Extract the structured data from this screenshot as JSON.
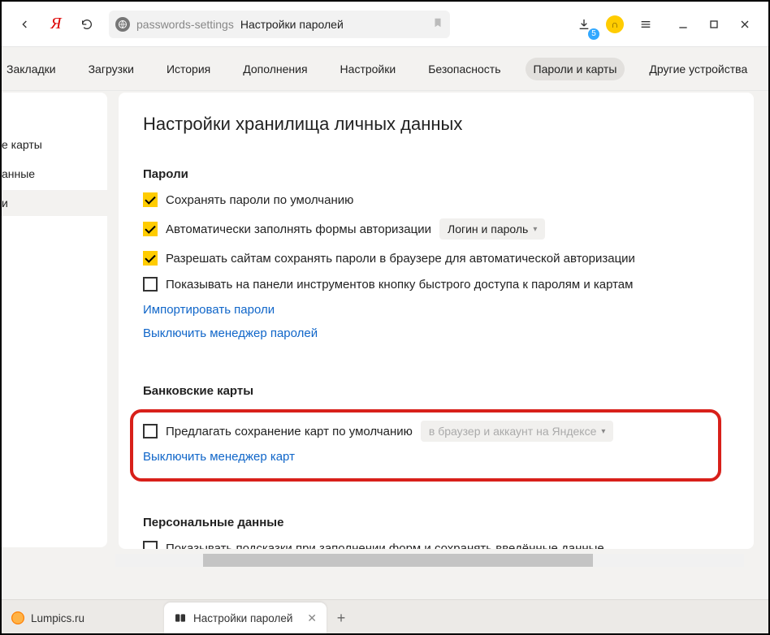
{
  "toolbar": {
    "download_badge": "5",
    "address_host": "passwords-settings",
    "address_title": "Настройки паролей"
  },
  "nav": {
    "items": [
      "Закладки",
      "Загрузки",
      "История",
      "Дополнения",
      "Настройки",
      "Безопасность",
      "Пароли и карты",
      "Другие устройства"
    ],
    "active_index": 6
  },
  "sidebar": {
    "items": [
      "е карты",
      "анные",
      "и"
    ],
    "selected_index": 2
  },
  "page": {
    "title": "Настройки хранилища личных данных"
  },
  "passwords": {
    "heading": "Пароли",
    "save_default": "Сохранять пароли по умолчанию",
    "autofill_forms": "Автоматически заполнять формы авторизации",
    "autofill_select": "Логин и пароль",
    "allow_sites": "Разрешать сайтам сохранять пароли в браузере для автоматической авторизации",
    "show_panel_button": "Показывать на панели инструментов кнопку быстрого доступа к паролям и картам",
    "import_link": "Импортировать пароли",
    "disable_link": "Выключить менеджер паролей"
  },
  "cards": {
    "heading": "Банковские карты",
    "offer_save": "Предлагать сохранение карт по умолчанию",
    "offer_select": "в браузер и аккаунт на Яндексе",
    "disable_link": "Выключить менеджер карт"
  },
  "personal": {
    "heading": "Персональные данные",
    "show_hints": "Показывать подсказки при заполнении форм и сохранять введённые данные"
  },
  "tabs": {
    "inactive": "Lumpics.ru",
    "active": "Настройки паролей"
  }
}
